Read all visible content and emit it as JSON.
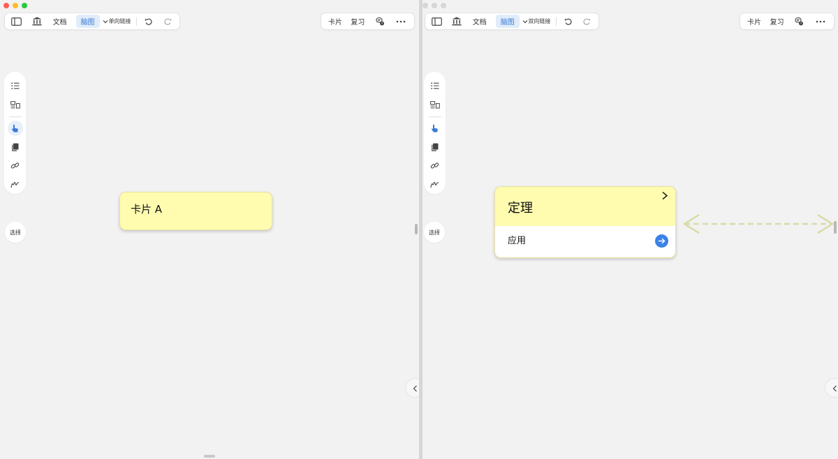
{
  "left_window": {
    "traffic_colors": [
      "#ff5f57",
      "#febc2e",
      "#28c840"
    ],
    "toolbar": {
      "doc_label": "文档",
      "mindmap_label": "脑图",
      "link_mode_label": "单向链接",
      "card_label": "卡片",
      "review_label": "复习"
    },
    "select_label": "选择",
    "card": {
      "title": "卡片 A"
    }
  },
  "right_window": {
    "traffic_colors": [
      "#d6d6d6",
      "#d6d6d6",
      "#d6d6d6"
    ],
    "toolbar": {
      "doc_label": "文档",
      "mindmap_label": "脑图",
      "link_mode_label": "双向链接",
      "card_label": "卡片",
      "review_label": "复习"
    },
    "select_label": "选择",
    "card": {
      "title": "定理",
      "sub_item": "应用"
    }
  },
  "colors": {
    "card_yellow": "#fffcaf",
    "accent_blue": "#3a7bd5",
    "link_dash": "#d8dca8"
  },
  "icons": [
    "sidebar-toggle-icon",
    "library-icon",
    "chevron-down-icon",
    "undo-icon",
    "redo-icon",
    "memory-icon",
    "more-icon",
    "list-icon",
    "layout-icon",
    "pointer-hand-icon",
    "copy-icon",
    "link-icon",
    "freehand-icon",
    "chevron-left-icon",
    "chevron-right-icon",
    "arrow-right-icon"
  ]
}
